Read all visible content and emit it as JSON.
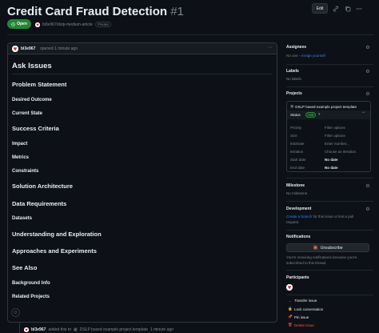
{
  "issue": {
    "title": "Credit Card Fraud Detection",
    "number": "#1",
    "state": "Open",
    "repo": "bl3e967/dslp-medium-article",
    "visibility": "Private"
  },
  "header_actions": {
    "edit_label": "Edit"
  },
  "comment": {
    "author": "bl3e967",
    "meta": "opened 1 minute ago",
    "body": {
      "h1_ask": "Ask Issues",
      "problem_statement": "Problem Statement",
      "desired_outcome": "Desired Outcome",
      "current_state": "Current State",
      "success_criteria": "Success Criteria",
      "impact": "Impact",
      "metrics": "Metrics",
      "constraints": "Constraints",
      "solution_architecture": "Solution Architecture",
      "data_requirements": "Data Requirements",
      "datasets": "Datasets",
      "understanding": "Understanding and Exploration",
      "approaches": "Approaches and Experiments",
      "see_also": "See Also",
      "background_info": "Background Info",
      "related_projects": "Related Projects"
    }
  },
  "timeline_event": {
    "user": "bl3e967",
    "text_before": "added this to",
    "project": "DSLP based example project template",
    "time": "1 minute ago"
  },
  "sidebar": {
    "assignees": {
      "label": "Assignees",
      "empty_text": "No one -",
      "assign_link": "Assign yourself"
    },
    "labels": {
      "label": "Labels",
      "empty_text": "No labels"
    },
    "projects": {
      "label": "Projects",
      "project_name": "DSLP based example project template",
      "status_label": "Status",
      "status_value": "Ask",
      "fields": [
        {
          "name": "Priority",
          "value": "Filter options",
          "strong": false
        },
        {
          "name": "Size",
          "value": "Filter options",
          "strong": false
        },
        {
          "name": "Estimate",
          "value": "Enter number...",
          "strong": false
        },
        {
          "name": "Iteration",
          "value": "Choose an iteration",
          "strong": false
        },
        {
          "name": "Start date",
          "value": "No date",
          "strong": true
        },
        {
          "name": "End date",
          "value": "No date",
          "strong": true
        }
      ]
    },
    "milestone": {
      "label": "Milestone",
      "empty_text": "No milestone"
    },
    "development": {
      "label": "Development",
      "link_text": "Create a branch",
      "rest_line1": "for this issue or link a pull",
      "rest_line2": "request."
    },
    "notifications": {
      "label": "Notifications",
      "button_label": "Unsubscribe",
      "info_line1": "You're receiving notifications because you're",
      "info_line2": "subscribed to this thread."
    },
    "participants": {
      "label": "Participants"
    },
    "actions": {
      "transfer": "Transfer issue",
      "lock": "Lock conversation",
      "pin": "Pin issue",
      "delete": "Delete issue"
    }
  },
  "colors": {
    "background": "#0d1117",
    "accent": "#2f81f7",
    "open_green": "#238636",
    "danger": "#f85149"
  },
  "icons": [
    "link-icon",
    "copy-icon",
    "more-icon",
    "open-issue-icon",
    "gear-icon",
    "smiley-icon",
    "project-table-icon",
    "bell-icon",
    "transfer-icon",
    "lock-icon",
    "pin-icon",
    "trash-icon"
  ]
}
